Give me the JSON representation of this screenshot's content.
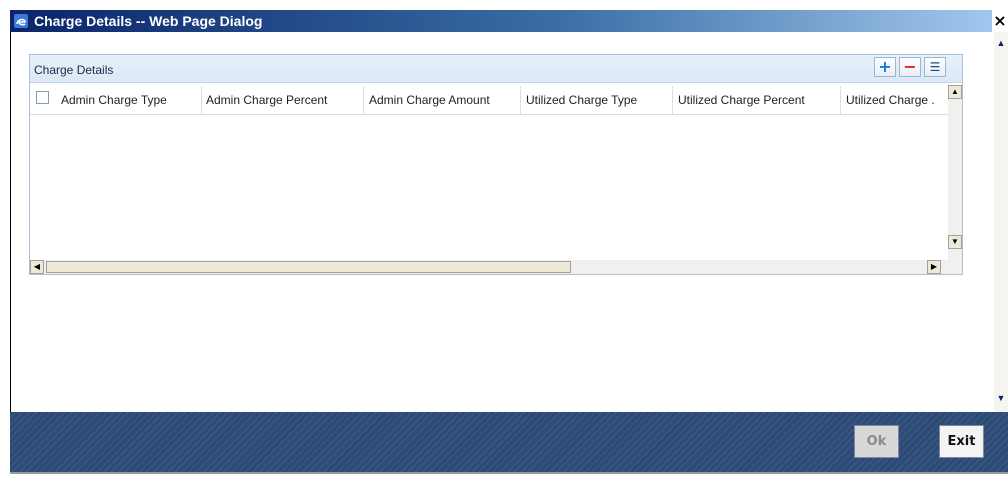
{
  "window": {
    "title": "Charge Details -- Web Page Dialog",
    "close_label": "×"
  },
  "panel": {
    "title": "Charge Details",
    "tools": {
      "add": "+",
      "delete": "−",
      "view": "☰"
    }
  },
  "grid": {
    "columns": [
      "Admin Charge Type",
      "Admin Charge Percent",
      "Admin Charge Amount",
      "Utilized Charge Type",
      "Utilized Charge Percent",
      "Utilized Charge ."
    ],
    "rows": []
  },
  "scroll": {
    "up": "▲",
    "down": "▼",
    "left": "◀",
    "right": "▶"
  },
  "footer": {
    "ok_label": "Ok",
    "exit_label": "Exit"
  },
  "colors": {
    "title_bar": "#0a246a",
    "footer": "#2c4a73",
    "panel_border": "#a9c1d9"
  }
}
